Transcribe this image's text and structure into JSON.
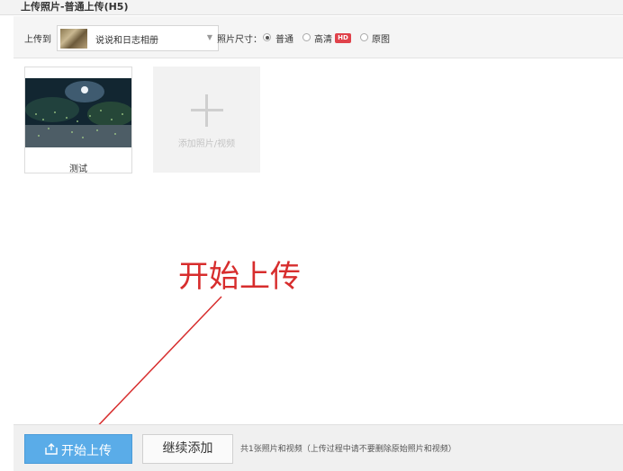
{
  "window": {
    "title": "上传照片-普通上传(H5)"
  },
  "toolbar": {
    "upload_to_label": "上传到",
    "album_name": "说说和日志相册",
    "size_label": "照片尺寸：",
    "size_options": [
      {
        "label": "普通",
        "selected": true
      },
      {
        "label": "高清",
        "selected": false
      },
      {
        "label": "原图",
        "selected": false
      }
    ],
    "hd_badge": "HD"
  },
  "photos": [
    {
      "caption": "测试"
    }
  ],
  "add_tile": {
    "label": "添加照片/视频"
  },
  "annotation": {
    "text": "开始上传",
    "color": "#d72d2d"
  },
  "footer": {
    "start_label": "开始上传",
    "continue_label": "继续添加",
    "status": "共1张照片和视频（上传过程中请不要删除原始照片和视频）"
  },
  "colors": {
    "primary_button": "#5aace8",
    "hd_badge": "#e0424b"
  },
  "icons": [
    "chevron-down-icon",
    "plus-icon",
    "upload-icon"
  ]
}
